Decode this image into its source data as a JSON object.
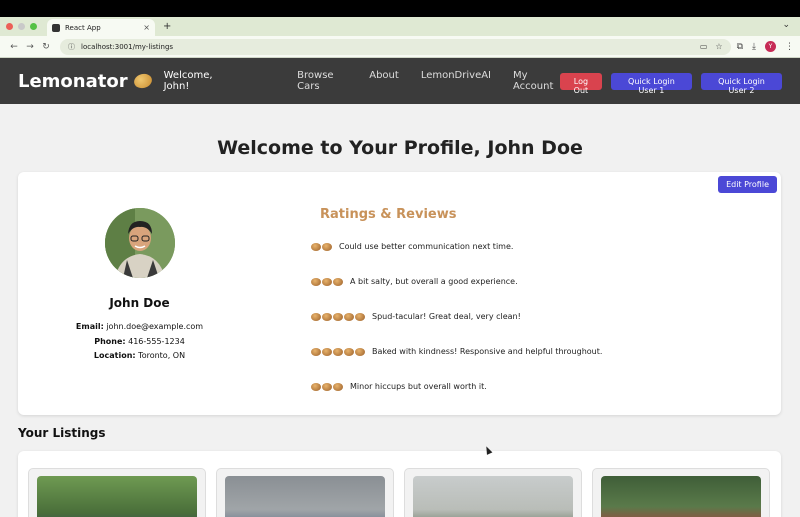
{
  "browser": {
    "tab_title": "React App",
    "url": "localhost:3001/my-listings",
    "profile_initial": "Y"
  },
  "nav": {
    "brand": "Lemonator",
    "welcome": "Welcome, John!",
    "links": [
      "Browse Cars",
      "About",
      "LemonDriveAI",
      "My Account"
    ],
    "logout": "Log Out",
    "quick1": "Quick Login User 1",
    "quick2": "Quick Login User 2"
  },
  "page": {
    "title": "Welcome to Your Profile, John Doe"
  },
  "profile": {
    "edit_label": "Edit Profile",
    "name": "John Doe",
    "email_label": "Email:",
    "email": "john.doe@example.com",
    "phone_label": "Phone:",
    "phone": "416-555-1234",
    "location_label": "Location:",
    "location": "Toronto, ON"
  },
  "ratings": {
    "title": "Ratings & Reviews",
    "reviews": [
      {
        "rating": 2,
        "text": "Could use better communication next time."
      },
      {
        "rating": 3,
        "text": "A bit salty, but overall a good experience."
      },
      {
        "rating": 5,
        "text": "Spud-tacular! Great deal, very clean!"
      },
      {
        "rating": 5,
        "text": "Baked with kindness! Responsive and helpful throughout."
      },
      {
        "rating": 3,
        "text": "Minor hiccups but overall worth it."
      }
    ]
  },
  "listings": {
    "title": "Your Listings"
  },
  "colors": {
    "accent_blue": "#4b48d6",
    "logout_red": "#d9434e",
    "ratings_gold": "#c8925a",
    "header_bg": "#3b3b3b"
  }
}
